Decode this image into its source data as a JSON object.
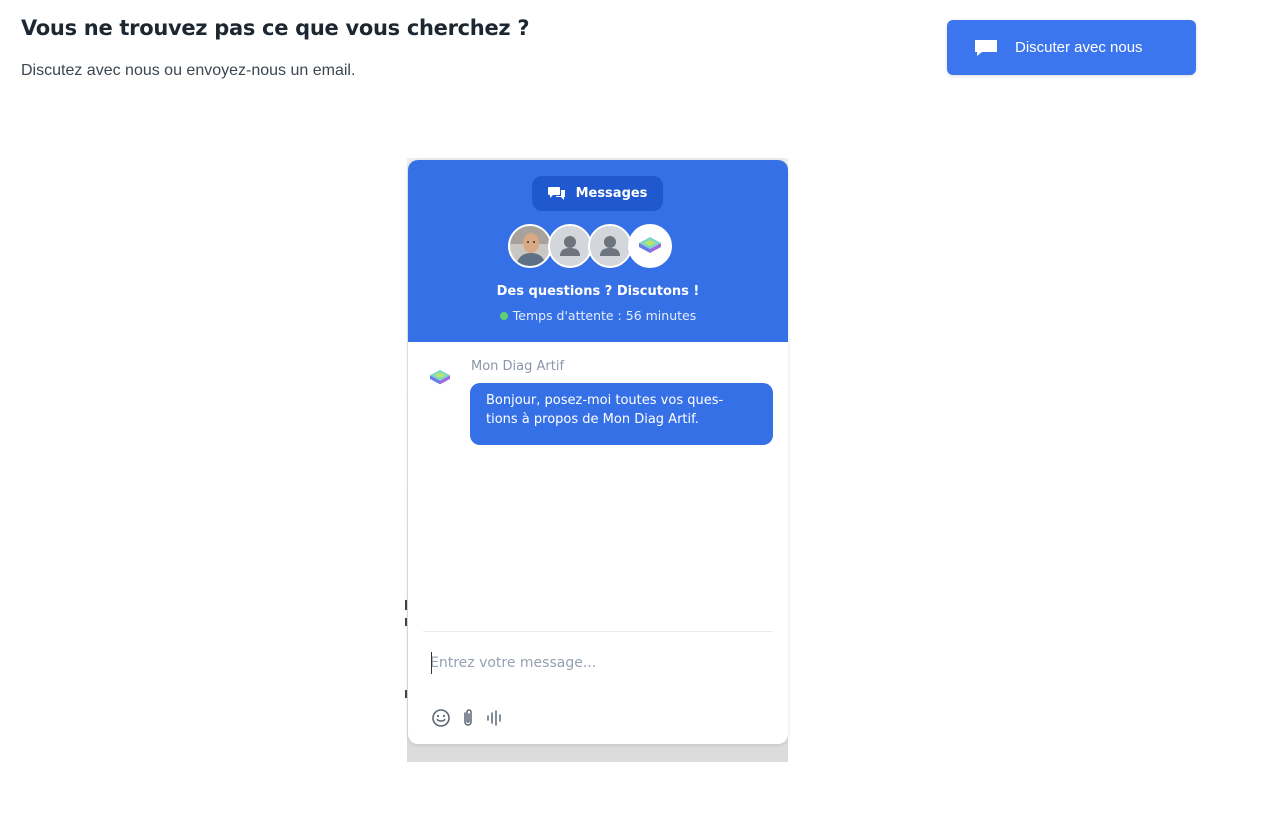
{
  "header": {
    "title": "Vous ne trouvez pas ce que vous cherchez ?",
    "subtitle": "Discutez avec nous ou envoyez-nous un email.",
    "cta_label": "Discuter avec nous",
    "cta_icon": "chat-bubble-icon"
  },
  "widget": {
    "messages_tab_label": "Messages",
    "messages_tab_icon": "conversation-icon",
    "title": "Des questions ? Discutons !",
    "wait_text": "Temps d'attente : 56 minutes",
    "status_color": "#5fd070",
    "accent_color": "#3670e6",
    "conversation": {
      "sender": "Mon Diag Artif",
      "message_line1": "Bonjour, posez-moi toutes vos ques-",
      "message_line2": "tions à propos de Mon Diag Artif."
    },
    "composer": {
      "placeholder": "Entrez votre message...",
      "tools": [
        "emoji-icon",
        "attachment-icon",
        "voice-message-icon"
      ]
    }
  }
}
